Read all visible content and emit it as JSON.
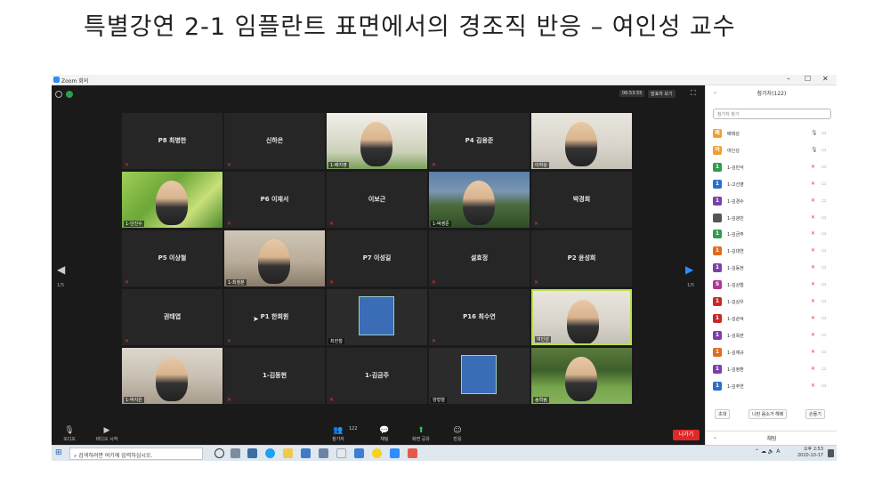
{
  "headline": "특별강연 2-1 임플란트 표면에서의 경조직 반응 – 여인성 교수",
  "window": {
    "title": "Zoom 회의",
    "controls": [
      "–",
      "☐",
      "✕"
    ]
  },
  "meeting": {
    "timer": "06:53:55",
    "speaker_view": "발표자 보기",
    "page_left": "1/5",
    "page_right": "1/5",
    "tiles": [
      {
        "name": "P8 최병한",
        "label": ""
      },
      {
        "name": "신하은",
        "label": ""
      },
      {
        "name": "",
        "label": "1-배지영"
      },
      {
        "name": "P4 김용준",
        "label": ""
      },
      {
        "name": "",
        "label": "이하상"
      },
      {
        "name": "",
        "label": "1-안진수"
      },
      {
        "name": "P6 이재서",
        "label": ""
      },
      {
        "name": "이보근",
        "label": ""
      },
      {
        "name": "",
        "label": "1-박영준"
      },
      {
        "name": "박경희",
        "label": ""
      },
      {
        "name": "P5 이상철",
        "label": ""
      },
      {
        "name": "",
        "label": "1-최정분"
      },
      {
        "name": "P7 이성길",
        "label": ""
      },
      {
        "name": "설효정",
        "label": ""
      },
      {
        "name": "P2 윤성희",
        "label": ""
      },
      {
        "name": "권태엽",
        "label": ""
      },
      {
        "name": "P1 한희원",
        "label": ""
      },
      {
        "name": "",
        "label": "최한철"
      },
      {
        "name": "P16 최수연",
        "label": ""
      },
      {
        "name": "",
        "label": "여인성"
      },
      {
        "name": "",
        "label": "1-박지은"
      },
      {
        "name": "1-김동현",
        "label": ""
      },
      {
        "name": "1-김금주",
        "label": ""
      },
      {
        "name": "",
        "label": "양형철"
      },
      {
        "name": "",
        "label": "송혁림"
      }
    ],
    "toolbar": {
      "audio": "오디오",
      "video": "비디오 시작",
      "participants": "참가자",
      "participants_count": "122",
      "chat": "채팅",
      "share": "화면 공유",
      "reactions": "반응",
      "end": "나가기"
    }
  },
  "panel": {
    "title": "참가자(122)",
    "search_placeholder": "참가자 찾기",
    "participants": [
      {
        "initial": "배",
        "name": "배태성",
        "color": "#f0a030"
      },
      {
        "initial": "여",
        "name": "여인성",
        "color": "#f0a030"
      },
      {
        "initial": "1",
        "name": "1-김민석",
        "color": "#2e9c4e"
      },
      {
        "initial": "1",
        "name": "1-고선영",
        "color": "#2a6fc9"
      },
      {
        "initial": "1",
        "name": "1-김경수",
        "color": "#7b3fa8"
      },
      {
        "initial": "",
        "name": "1-김광민",
        "color": "#555555"
      },
      {
        "initial": "1",
        "name": "1-김금주",
        "color": "#2e9c4e"
      },
      {
        "initial": "1",
        "name": "1-김대연",
        "color": "#e06a1f"
      },
      {
        "initial": "1",
        "name": "1-김동현",
        "color": "#7b3fa8"
      },
      {
        "initial": "S",
        "name": "1-김상철",
        "color": "#b0349a"
      },
      {
        "initial": "1",
        "name": "1-김상우",
        "color": "#c62828"
      },
      {
        "initial": "1",
        "name": "1-김순덕",
        "color": "#c62828"
      },
      {
        "initial": "1",
        "name": "1-김옥련",
        "color": "#7b3fa8"
      },
      {
        "initial": "1",
        "name": "1-김재규",
        "color": "#e06a1f"
      },
      {
        "initial": "1",
        "name": "1-김정환",
        "color": "#7b3fa8"
      },
      {
        "initial": "1",
        "name": "1-김주연",
        "color": "#2a6fc9"
      }
    ],
    "invite": "초대",
    "mute_all": "나란 음소거 해제",
    "raise_hand": "손들기",
    "chat": "채팅"
  },
  "taskbar": {
    "search": "검색하려면 여기에 입력하십시오.",
    "ime": "A",
    "time": "오후 2:53",
    "date": "2020-10-17"
  }
}
